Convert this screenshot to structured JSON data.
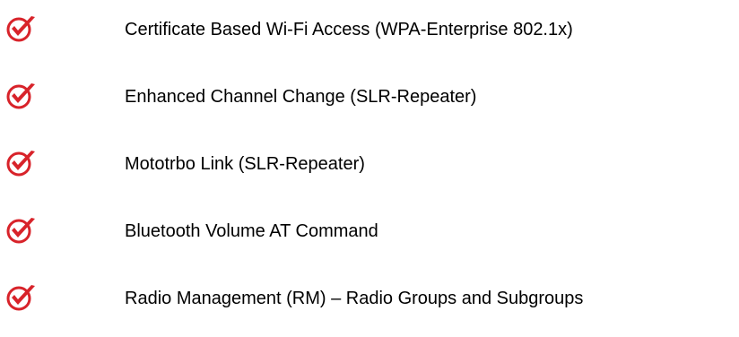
{
  "theme": {
    "check_color": "#d8232a",
    "text_color": "#000000"
  },
  "features": {
    "icon": "red-checkmark-icon",
    "items": [
      {
        "label": "Certificate Based Wi-Fi Access (WPA-Enterprise 802.1x)"
      },
      {
        "label": "Enhanced Channel Change (SLR-Repeater)"
      },
      {
        "label": "Mototrbo Link (SLR-Repeater)"
      },
      {
        "label": "Bluetooth Volume AT Command"
      },
      {
        "label": "Radio Management (RM) – Radio Groups and Subgroups"
      }
    ]
  }
}
